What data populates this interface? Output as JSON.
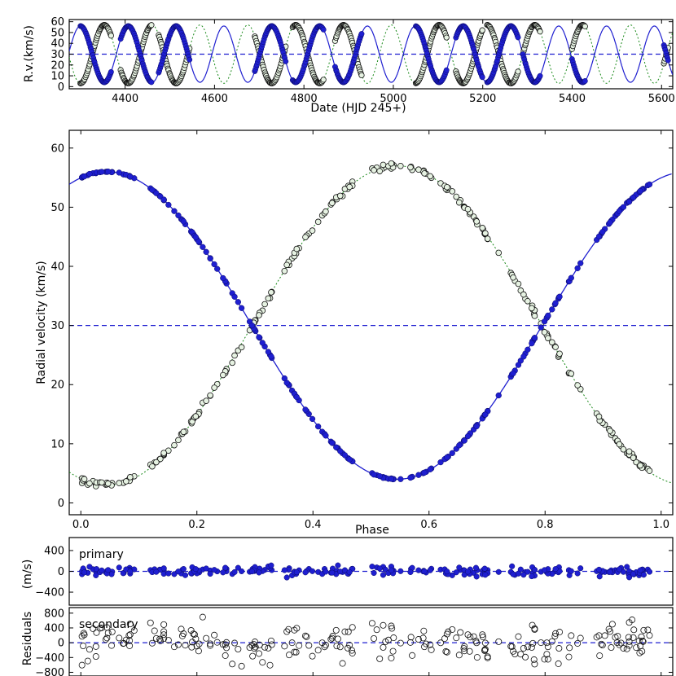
{
  "colors": {
    "primary": "#1f1fd0",
    "secondary_edge": "#111111",
    "secondary_fill": "#e6f2e2",
    "gamma": "#1f1fd0",
    "secondary_curve": "#1a8a1a"
  },
  "chart_data": [
    {
      "panel": "top",
      "type": "line",
      "xlabel": "Date (HJD 245+)",
      "ylabel": "R.v.(km/s)",
      "xlim": [
        4275,
        5625
      ],
      "ylim": [
        -2,
        62
      ],
      "xticks": [
        4400,
        4600,
        4800,
        5000,
        5200,
        5400,
        5600
      ],
      "yticks": [
        0,
        10,
        20,
        30,
        40,
        50,
        60
      ],
      "orbit": {
        "gamma": 30.0,
        "K1": 26.0,
        "K2": 27.0,
        "period": 107.0,
        "t0": 4300.0
      },
      "observation_windows": [
        [
          4300,
          4370
        ],
        [
          4390,
          4460
        ],
        [
          4475,
          4545
        ],
        [
          4690,
          4760
        ],
        [
          4775,
          4845
        ],
        [
          4870,
          4930
        ],
        [
          5050,
          5120
        ],
        [
          5140,
          5200
        ],
        [
          5210,
          5280
        ],
        [
          5290,
          5330
        ],
        [
          5400,
          5430
        ],
        [
          5605,
          5615
        ]
      ],
      "series": []
    },
    {
      "panel": "main",
      "type": "scatter",
      "xlabel": "Phase",
      "ylabel": "Radial velocity (km/s)",
      "xlim": [
        -0.02,
        1.02
      ],
      "ylim": [
        -2,
        63
      ],
      "xticks": [
        0.0,
        0.2,
        0.4,
        0.6,
        0.8,
        1.0
      ],
      "yticks": [
        0,
        10,
        20,
        30,
        40,
        50,
        60
      ],
      "gamma": 30.0,
      "model": {
        "primary": {
          "amplitude": 26.0,
          "max_phase": 0.045
        },
        "secondary": {
          "amplitude": 27.0,
          "min_phase": 0.045
        }
      },
      "observed_phase_ranges": [
        [
          0.0,
          0.1
        ],
        [
          0.12,
          0.47
        ],
        [
          0.5,
          0.72
        ],
        [
          0.74,
          1.0
        ]
      ],
      "series": []
    },
    {
      "panel": "residuals-primary",
      "type": "scatter",
      "label": "primary",
      "xlim": [
        -0.02,
        1.02
      ],
      "ylim": [
        -650,
        650
      ],
      "yticks": [
        -400,
        0,
        400
      ],
      "scatter_sd": 45,
      "series": []
    },
    {
      "panel": "residuals-secondary",
      "type": "scatter",
      "label": "secondary",
      "ylabel": "Residuals",
      "xlim": [
        -0.02,
        1.02
      ],
      "ylim": [
        -900,
        950
      ],
      "yticks": [
        -800,
        -400,
        0,
        400,
        800
      ],
      "scatter_sd": 250,
      "series": []
    }
  ],
  "shared": {
    "residuals_unit_label": "(m/s)"
  }
}
